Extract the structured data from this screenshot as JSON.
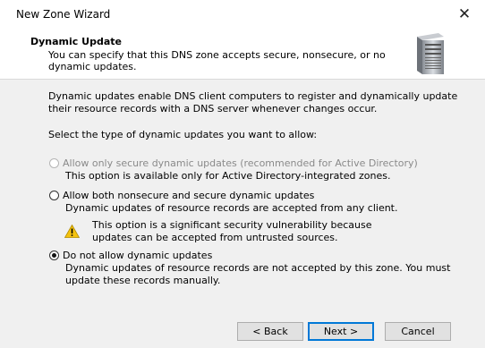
{
  "window": {
    "title": "New Zone Wizard"
  },
  "header": {
    "title": "Dynamic Update",
    "description": "You can specify that this DNS zone accepts secure, nonsecure, or no dynamic updates.",
    "icon": "server-icon"
  },
  "body": {
    "intro": "Dynamic updates enable DNS client computers to register and dynamically update their resource records with a DNS server whenever changes occur.",
    "prompt": "Select the type of dynamic updates you want to allow:",
    "options": [
      {
        "label": "Allow only secure dynamic updates (recommended for Active Directory)",
        "sub": "This option is available only for Active Directory-integrated zones.",
        "enabled": false,
        "selected": false
      },
      {
        "label": "Allow both nonsecure and secure dynamic updates",
        "sub": "Dynamic updates of resource records are accepted from any client.",
        "warning": "This option is a significant security vulnerability because updates can be accepted from untrusted sources.",
        "enabled": true,
        "selected": false
      },
      {
        "label": "Do not allow dynamic updates",
        "sub": "Dynamic updates of resource records are not accepted by this zone. You must update these records manually.",
        "enabled": true,
        "selected": true
      }
    ]
  },
  "buttons": {
    "back": "< Back",
    "next": "Next >",
    "cancel": "Cancel"
  },
  "colors": {
    "accent": "#0078d7",
    "panel_bg": "#f0f0f0",
    "warning": "#f4c20d"
  }
}
